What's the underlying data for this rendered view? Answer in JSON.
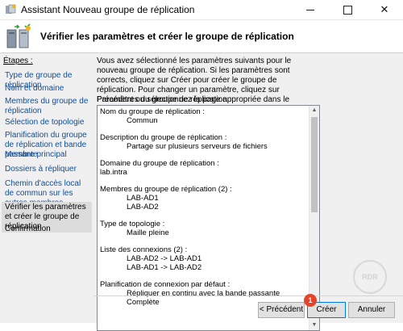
{
  "window": {
    "title": "Assistant Nouveau groupe de réplication",
    "minimize_icon": "minimize-icon",
    "maximize_icon": "maximize-icon",
    "close_icon": "close-icon",
    "close_glyph": "✕"
  },
  "header": {
    "title": "Vérifier les paramètres et créer le groupe de réplication",
    "icon": "replication-wizard-icon"
  },
  "steps": {
    "title": "Étapes :",
    "items": [
      {
        "label": "Type de groupe de réplication"
      },
      {
        "label": "Nom et domaine"
      },
      {
        "label": "Membres du groupe de réplication"
      },
      {
        "label": "Sélection de topologie"
      },
      {
        "label": "Planification du groupe de réplication et bande passante"
      },
      {
        "label": "Membre principal"
      },
      {
        "label": "Dossiers à répliquer"
      },
      {
        "label": "Chemin d'accès local de commun sur les autres membres"
      },
      {
        "label": "Vérifier les paramètres et créer le groupe de réplication"
      },
      {
        "label": "Confirmation"
      }
    ]
  },
  "main": {
    "intro": "Vous avez sélectionné les paramètres suivants pour le nouveau groupe de réplication. Si les paramètres sont corrects, cliquez sur Créer pour créer le groupe de réplication. Pour changer un paramètre, cliquez sur Précédent ou sélectionnez la page appropriée dans le volet d'orientation.",
    "params_label": "Paramètres du groupe de réplication :",
    "settings": {
      "name_label": "Nom du groupe de réplication :",
      "name_value": "Commun",
      "desc_label": "Description du groupe de réplication :",
      "desc_value": "Partage sur plusieurs serveurs de fichiers",
      "domain_label": "Domaine du groupe de réplication :",
      "domain_value": "lab.intra",
      "members_label": "Membres du groupe de réplication (2) :",
      "member1": "LAB-AD1",
      "member2": "LAB-AD2",
      "topology_label": "Type de topologie :",
      "topology_value": "Maille pleine",
      "connections_label": "Liste des connexions (2) :",
      "conn1": "LAB-AD2 -> LAB-AD1",
      "conn2": "LAB-AD1 -> LAB-AD2",
      "schedule_label": "Planification de connexion par défaut :",
      "schedule_value": "Répliquer en continu avec la bande passante Complète"
    },
    "scroll_up_glyph": "▲",
    "scroll_down_glyph": "▼"
  },
  "watermark": "RDR",
  "buttons": {
    "previous": "< Précédent",
    "create": "Créer",
    "cancel": "Annuler"
  },
  "badge": "1",
  "colors": {
    "link": "#0b4f9e",
    "badge": "#e2452c",
    "focus_border": "#0078d7"
  }
}
